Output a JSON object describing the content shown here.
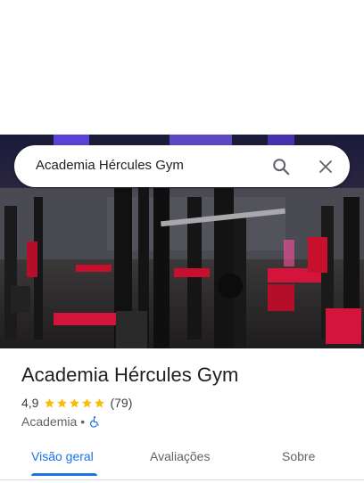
{
  "search": {
    "query": "Academia Hércules Gym"
  },
  "place": {
    "name": "Academia Hércules Gym",
    "rating": "4,9",
    "stars": 5,
    "review_count": "(79)",
    "category": "Academia",
    "separator": "•"
  },
  "tabs": [
    {
      "label": "Visão geral",
      "active": true
    },
    {
      "label": "Avaliações",
      "active": false
    },
    {
      "label": "Sobre",
      "active": false
    }
  ],
  "colors": {
    "accent": "#1a73e8",
    "star": "#fbbc04",
    "gym_red": "#d4143a"
  },
  "icons": {
    "search": "search-icon",
    "close": "close-icon",
    "accessibility": "wheelchair-icon",
    "star": "star-icon"
  }
}
